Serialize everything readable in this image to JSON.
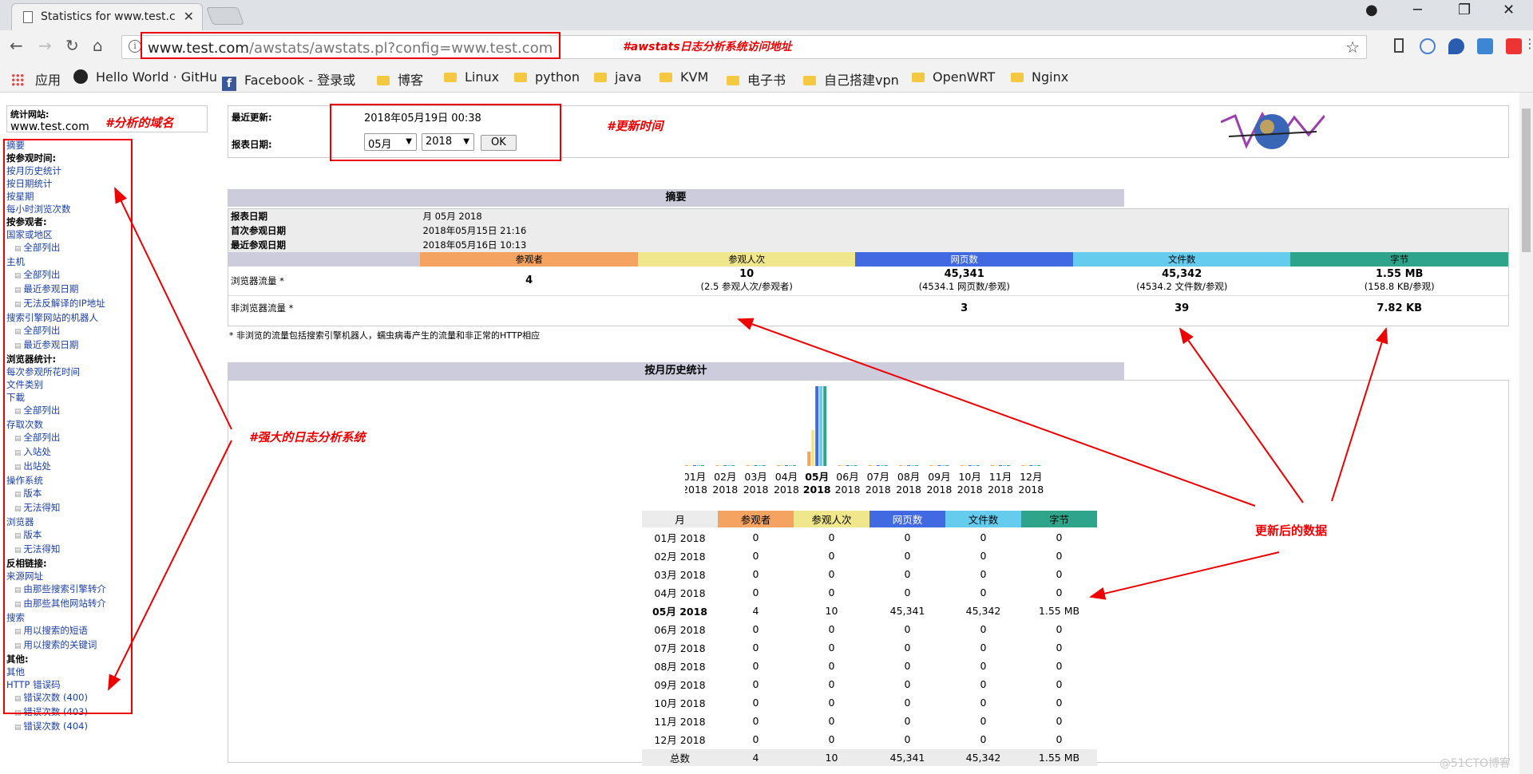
{
  "browser": {
    "tab_title": "Statistics for www.test.c",
    "url_host": "www.test.com",
    "url_path": "/awstats/awstats.pl?config=www.test.com",
    "bookmarks": [
      "应用",
      "Hello World · GitHu",
      "Facebook - 登录或",
      "博客",
      "Linux",
      "python",
      "java",
      "KVM",
      "电子书",
      "自己搭建vpn",
      "OpenWRT",
      "Nginx"
    ]
  },
  "site": {
    "label": "统计网站:",
    "value": "www.test.com"
  },
  "menu": [
    {
      "t": "a",
      "text": "摘要"
    },
    {
      "t": "h",
      "text": "按参观时间:"
    },
    {
      "t": "a",
      "text": "按月历史统计"
    },
    {
      "t": "a",
      "text": "按日期统计"
    },
    {
      "t": "a",
      "text": "按星期"
    },
    {
      "t": "a",
      "text": "每小时浏览次数"
    },
    {
      "t": "h",
      "text": "按参观者:"
    },
    {
      "t": "a",
      "text": "国家或地区"
    },
    {
      "t": "s",
      "text": "全部列出"
    },
    {
      "t": "a",
      "text": "主机"
    },
    {
      "t": "s",
      "text": "全部列出"
    },
    {
      "t": "s",
      "text": "最近参观日期"
    },
    {
      "t": "s",
      "text": "无法反解译的IP地址"
    },
    {
      "t": "a",
      "text": "搜索引擎网站的机器人"
    },
    {
      "t": "s",
      "text": "全部列出"
    },
    {
      "t": "s",
      "text": "最近参观日期"
    },
    {
      "t": "h",
      "text": "浏览器统计:"
    },
    {
      "t": "a",
      "text": "每次参观所花时间"
    },
    {
      "t": "a",
      "text": "文件类别"
    },
    {
      "t": "a",
      "text": "下載"
    },
    {
      "t": "s",
      "text": "全部列出"
    },
    {
      "t": "a",
      "text": "存取次数"
    },
    {
      "t": "s",
      "text": "全部列出"
    },
    {
      "t": "s",
      "text": "入站处"
    },
    {
      "t": "s",
      "text": "出站处"
    },
    {
      "t": "a",
      "text": "操作系统"
    },
    {
      "t": "s",
      "text": "版本"
    },
    {
      "t": "s",
      "text": "无法得知"
    },
    {
      "t": "a",
      "text": "浏览器"
    },
    {
      "t": "s",
      "text": "版本"
    },
    {
      "t": "s",
      "text": "无法得知"
    },
    {
      "t": "h",
      "text": "反相链接:"
    },
    {
      "t": "a",
      "text": "来源网址"
    },
    {
      "t": "s",
      "text": "由那些搜索引擎转介"
    },
    {
      "t": "s",
      "text": "由那些其他网站转介"
    },
    {
      "t": "a",
      "text": "搜索"
    },
    {
      "t": "s",
      "text": "用以搜索的短语"
    },
    {
      "t": "s",
      "text": "用以搜索的关键词"
    },
    {
      "t": "h",
      "text": "其他:"
    },
    {
      "t": "a",
      "text": "其他"
    },
    {
      "t": "a",
      "text": "HTTP 错误码"
    },
    {
      "t": "s",
      "text": "错误次数 (400)"
    },
    {
      "t": "s",
      "text": "错误次数 (403)"
    },
    {
      "t": "s",
      "text": "错误次数 (404)"
    }
  ],
  "header": {
    "last_update_label": "最近更新:",
    "last_update_value": "2018年05月19日 00:38",
    "report_date_label": "报表日期:",
    "month_select": "05月",
    "year_select": "2018",
    "ok_label": "OK"
  },
  "summary": {
    "title": "摘要",
    "report_date_label": "报表日期",
    "report_date_value": "月 05月 2018",
    "first_visit_label": "首次参观日期",
    "first_visit_value": "2018年05月15日 21:16",
    "last_visit_label": "最近参观日期",
    "last_visit_value": "2018年05月16日 10:13",
    "columns": [
      "参观者",
      "参观人次",
      "网页数",
      "文件数",
      "字节"
    ],
    "column_colors": [
      "#f4a460",
      "#f0e68c",
      "#4169e1",
      "#66ccee",
      "#2ea58a"
    ],
    "viewed_label": "浏览器流量 *",
    "viewed": [
      "4",
      "10",
      "45,341",
      "45,342",
      "1.55 MB"
    ],
    "viewed_sub": [
      "",
      "(2.5 参观人次/参观者)",
      "(4534.1 网页数/参观)",
      "(4534.2 文件数/参观)",
      "(158.8 KB/参观)"
    ],
    "not_viewed_label": "非浏览器流量 *",
    "not_viewed": [
      "3",
      "39",
      "7.82 KB"
    ],
    "footnote": "* 非浏览的流量包括搜索引擎机器人，蠕虫病毒产生的流量和非正常的HTTP相应"
  },
  "monthly": {
    "title": "按月历史统计",
    "month_labels": [
      "01月",
      "02月",
      "03月",
      "04月",
      "05月",
      "06月",
      "07月",
      "08月",
      "09月",
      "10月",
      "11月",
      "12月"
    ],
    "year_label": "2018",
    "table_headers": [
      "月",
      "参观者",
      "参观人次",
      "网页数",
      "文件数",
      "字节"
    ],
    "rows": [
      [
        "01月 2018",
        "0",
        "0",
        "0",
        "0",
        "0"
      ],
      [
        "02月 2018",
        "0",
        "0",
        "0",
        "0",
        "0"
      ],
      [
        "03月 2018",
        "0",
        "0",
        "0",
        "0",
        "0"
      ],
      [
        "04月 2018",
        "0",
        "0",
        "0",
        "0",
        "0"
      ],
      [
        "05月 2018",
        "4",
        "10",
        "45,341",
        "45,342",
        "1.55 MB"
      ],
      [
        "06月 2018",
        "0",
        "0",
        "0",
        "0",
        "0"
      ],
      [
        "07月 2018",
        "0",
        "0",
        "0",
        "0",
        "0"
      ],
      [
        "08月 2018",
        "0",
        "0",
        "0",
        "0",
        "0"
      ],
      [
        "09月 2018",
        "0",
        "0",
        "0",
        "0",
        "0"
      ],
      [
        "10月 2018",
        "0",
        "0",
        "0",
        "0",
        "0"
      ],
      [
        "11月 2018",
        "0",
        "0",
        "0",
        "0",
        "0"
      ],
      [
        "12月 2018",
        "0",
        "0",
        "0",
        "0",
        "0"
      ]
    ],
    "total": [
      "总数",
      "4",
      "10",
      "45,341",
      "45,342",
      "1.55 MB"
    ]
  },
  "chart_data": {
    "type": "bar",
    "categories": [
      "01月 2018",
      "02月 2018",
      "03月 2018",
      "04月 2018",
      "05月 2018",
      "06月 2018",
      "07月 2018",
      "08月 2018",
      "09月 2018",
      "10月 2018",
      "11月 2018",
      "12月 2018"
    ],
    "series": [
      {
        "name": "参观者",
        "values": [
          0,
          0,
          0,
          0,
          4,
          0,
          0,
          0,
          0,
          0,
          0,
          0
        ]
      },
      {
        "name": "参观人次",
        "values": [
          0,
          0,
          0,
          0,
          10,
          0,
          0,
          0,
          0,
          0,
          0,
          0
        ]
      },
      {
        "name": "网页数",
        "values": [
          0,
          0,
          0,
          0,
          45341,
          0,
          0,
          0,
          0,
          0,
          0,
          0
        ]
      },
      {
        "name": "文件数",
        "values": [
          0,
          0,
          0,
          0,
          45342,
          0,
          0,
          0,
          0,
          0,
          0,
          0
        ]
      },
      {
        "name": "字节",
        "values": [
          0,
          0,
          0,
          0,
          1.55,
          0,
          0,
          0,
          0,
          0,
          0,
          0
        ]
      }
    ],
    "colors": [
      "#f4a460",
      "#f0e68c",
      "#4169e1",
      "#66ccee",
      "#2ea58a"
    ]
  },
  "annotations": {
    "url_note": "#awstats日志分析系统访问地址",
    "domain_note": "#分析的域名",
    "time_note": "#更新时间",
    "system_note": "#强大的日志分析系统",
    "data_note": "更新后的数据"
  },
  "watermark": "@51CTO博客"
}
